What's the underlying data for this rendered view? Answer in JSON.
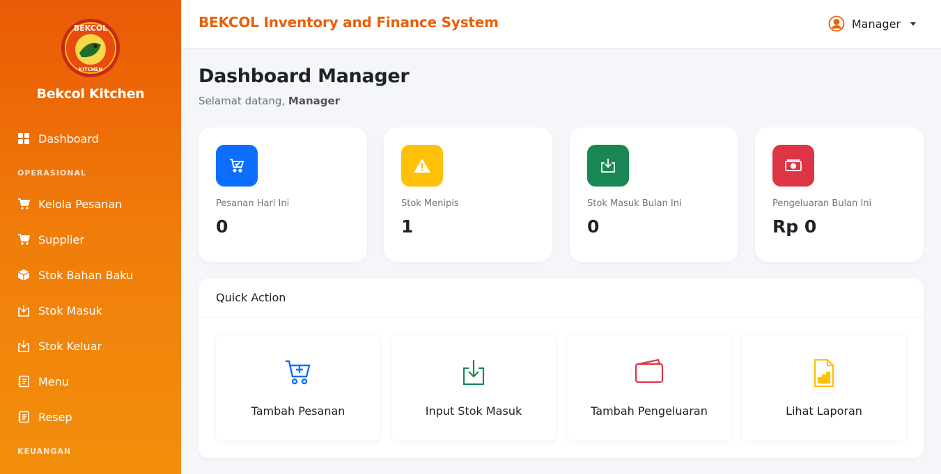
{
  "sidebar": {
    "brand": "Bekcol Kitchen",
    "logo_text_top": "BEKCOL",
    "logo_text_bottom": "KITCHEN",
    "items": [
      {
        "label": "Dashboard"
      },
      {
        "label": "Kelola Pesanan"
      },
      {
        "label": "Supplier"
      },
      {
        "label": "Stok Bahan Baku"
      },
      {
        "label": "Stok Masuk"
      },
      {
        "label": "Stok Keluar"
      },
      {
        "label": "Menu"
      },
      {
        "label": "Resep"
      }
    ],
    "sections": {
      "operasional": "OPERASIONAL",
      "keuangan": "KEUANGAN"
    }
  },
  "header": {
    "title": "BEKCOL Inventory and Finance System",
    "user": "Manager"
  },
  "main": {
    "page_title": "Dashboard Manager",
    "welcome_prefix": "Selamat datang, ",
    "welcome_user": "Manager",
    "cards": [
      {
        "label": "Pesanan Hari Ini",
        "value": "0",
        "color": "#0d6efd",
        "icon": "cart-check-icon"
      },
      {
        "label": "Stok Menipis",
        "value": "1",
        "color": "#ffc107",
        "icon": "warning-icon"
      },
      {
        "label": "Stok Masuk Bulan Ini",
        "value": "0",
        "color": "#198754",
        "icon": "box-arrow-in-icon"
      },
      {
        "label": "Pengeluaran Bulan Ini",
        "value": "Rp 0",
        "color": "#dc3545",
        "icon": "cash-icon"
      }
    ],
    "quick_action": {
      "title": "Quick Action",
      "buttons": [
        {
          "label": "Tambah Pesanan",
          "color": "#0d6efd",
          "icon": "cart-plus-icon"
        },
        {
          "label": "Input Stok Masuk",
          "color": "#198754",
          "icon": "download-icon"
        },
        {
          "label": "Tambah Pengeluaran",
          "color": "#dc3545",
          "icon": "wallet-icon"
        },
        {
          "label": "Lihat Laporan",
          "color": "#ffc107",
          "icon": "report-chart-icon"
        }
      ]
    }
  }
}
